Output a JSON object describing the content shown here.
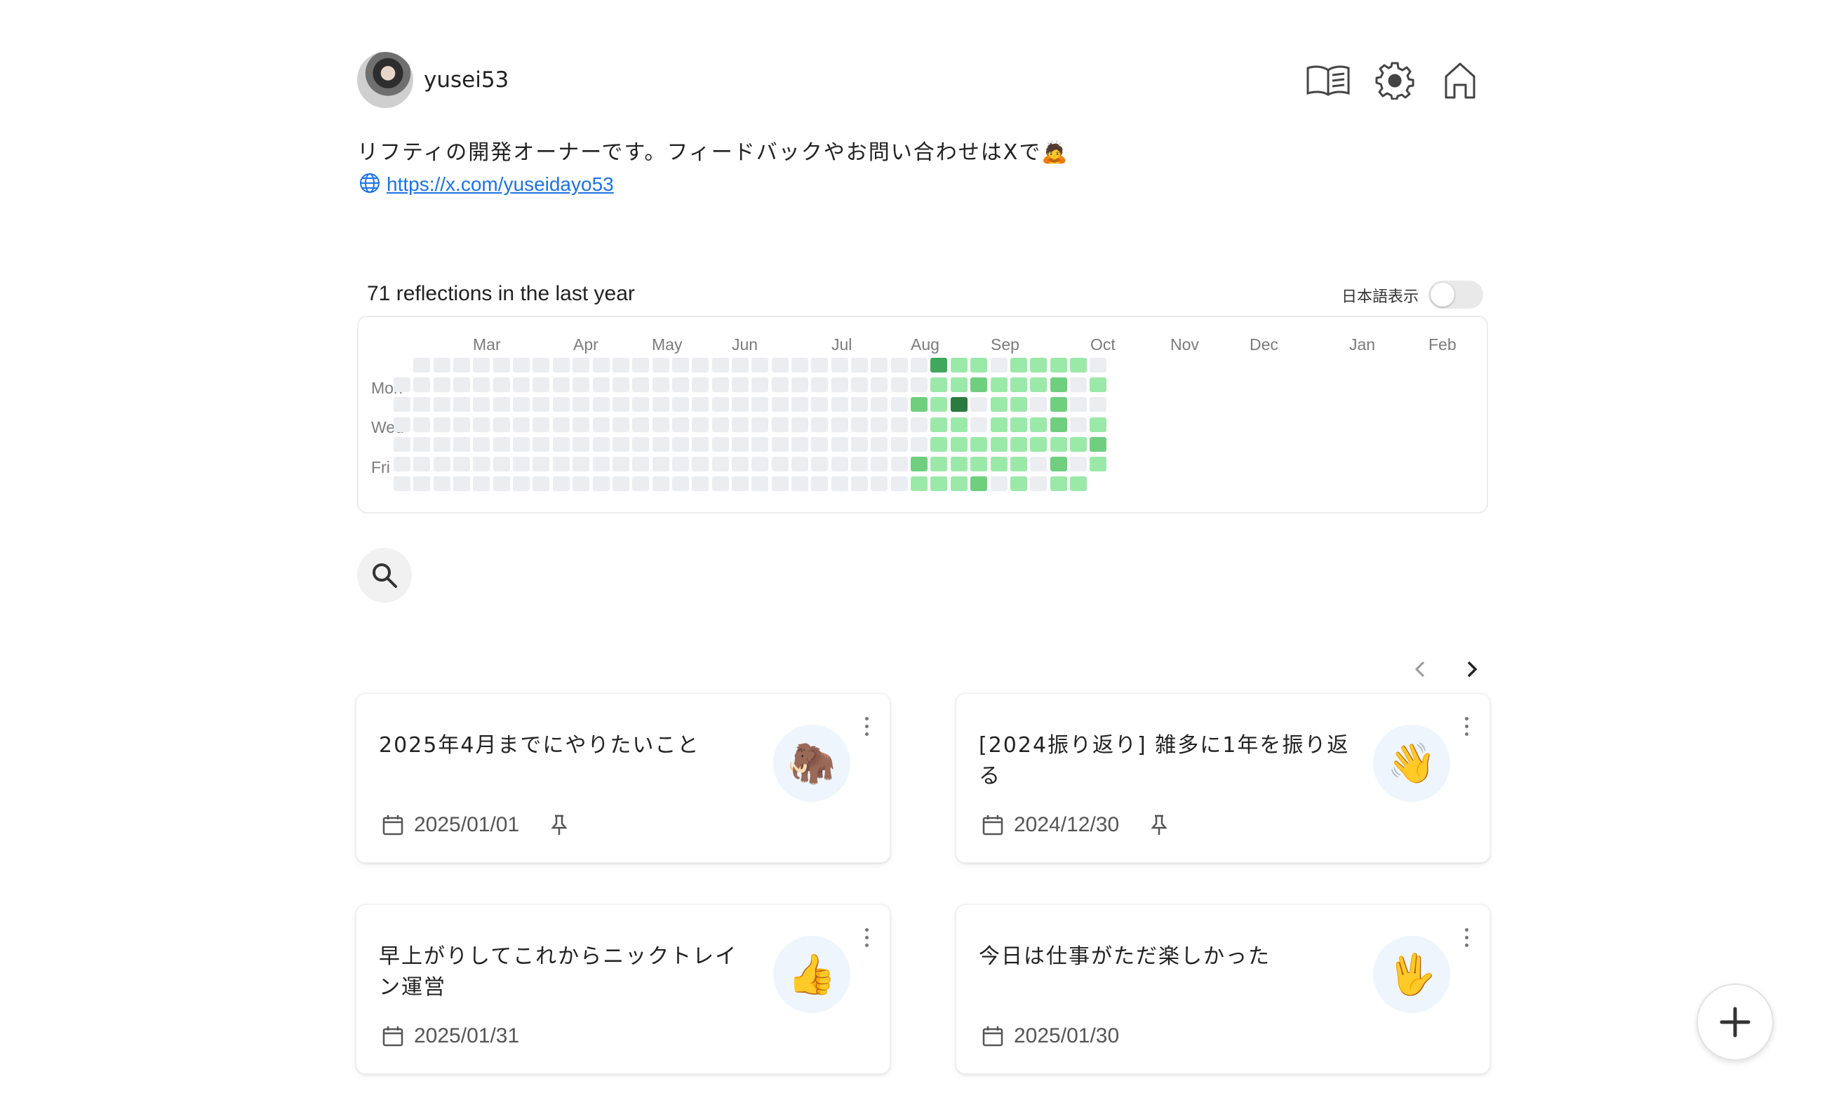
{
  "profile": {
    "username": "yusei53",
    "bio": "リフティの開発オーナーです。フィードバックやお問い合わせはXで🙇",
    "link": "https://x.com/yuseidayo53"
  },
  "header_icons": [
    "book-icon",
    "gear-icon",
    "home-icon"
  ],
  "heatmap": {
    "summary": "71 reflections in the last year",
    "toggle_label": "日本語表示",
    "toggle_on": false,
    "months": [
      "Mar",
      "Apr",
      "May",
      "Jun",
      "Jul",
      "Aug",
      "Sep",
      "Oct",
      "Nov",
      "Dec",
      "Jan",
      "Feb"
    ],
    "day_labels": [
      "Mon",
      "Wed",
      "Fri"
    ],
    "colors": {
      "empty": "#ebedf0",
      "level1": "#9be9a8",
      "level2": "#6fcf7f",
      "level3": "#40a85a",
      "level4": "#2b7a3f"
    }
  },
  "pagination": {
    "prev": "‹",
    "next": "›"
  },
  "cards": [
    {
      "title": "2025年4月までにやりたいこと",
      "date": "2025/01/01",
      "emoji": "🦣",
      "pinned": true
    },
    {
      "title": "[2024振り返り] 雑多に1年を振り返る",
      "date": "2024/12/30",
      "emoji": "👋",
      "pinned": true
    },
    {
      "title": "早上がりしてこれからニックトレイン運営",
      "date": "2025/01/31",
      "emoji": "👍",
      "pinned": false
    },
    {
      "title": "今日は仕事がただ楽しかった",
      "date": "2025/01/30",
      "emoji": "🖖",
      "pinned": false
    }
  ]
}
